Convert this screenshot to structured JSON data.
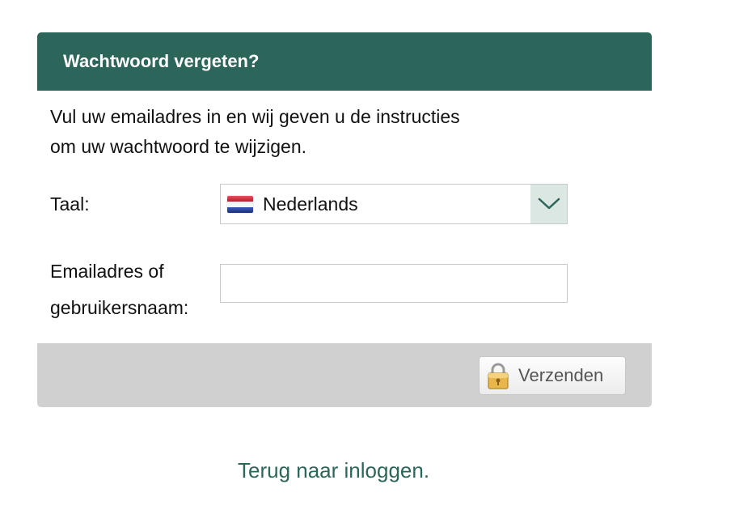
{
  "header": {
    "title": "Wachtwoord vergeten?"
  },
  "intro": {
    "line1": "Vul uw emailadres in en wij geven u de instructies",
    "line2": "om uw wachtwoord te wijzigen."
  },
  "language": {
    "label": "Taal:",
    "selected": "Nederlands",
    "flag_icon": "netherlands-flag-icon"
  },
  "email": {
    "label_line1": "Emailadres of",
    "label_line2": "gebruikersnaam:",
    "value": "",
    "placeholder": ""
  },
  "actions": {
    "submit_label": "Verzenden",
    "submit_icon": "lock-icon"
  },
  "back_link": "Terug naar inloggen.",
  "colors": {
    "accent": "#2c6559",
    "footer_bar": "#d0d0d0"
  }
}
